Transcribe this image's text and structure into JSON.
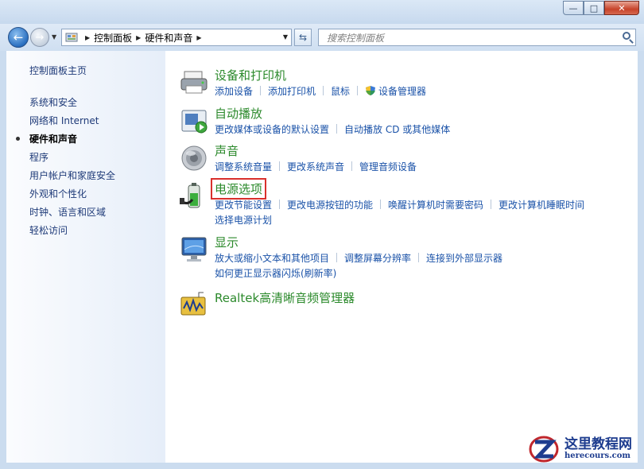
{
  "window": {
    "minimize_glyph": "—",
    "maximize_glyph": "□",
    "close_glyph": "✕"
  },
  "navbar": {
    "breadcrumb": [
      "控制面板",
      "硬件和声音"
    ],
    "search_placeholder": "搜索控制面板"
  },
  "sidebar": {
    "home": "控制面板主页",
    "items": [
      {
        "label": "系统和安全",
        "active": false
      },
      {
        "label": "网络和 Internet",
        "active": false
      },
      {
        "label": "硬件和声音",
        "active": true
      },
      {
        "label": "程序",
        "active": false
      },
      {
        "label": "用户帐户和家庭安全",
        "active": false
      },
      {
        "label": "外观和个性化",
        "active": false
      },
      {
        "label": "时钟、语言和区域",
        "active": false
      },
      {
        "label": "轻松访问",
        "active": false
      }
    ]
  },
  "categories": [
    {
      "title": "设备和打印机",
      "icon": "printer-icon",
      "rows": [
        [
          "添加设备",
          "添加打印机",
          "鼠标",
          "设备管理器"
        ]
      ]
    },
    {
      "title": "自动播放",
      "icon": "autoplay-icon",
      "rows": [
        [
          "更改媒体或设备的默认设置",
          "自动播放 CD 或其他媒体"
        ]
      ]
    },
    {
      "title": "声音",
      "icon": "speaker-icon",
      "rows": [
        [
          "调整系统音量",
          "更改系统声音",
          "管理音频设备"
        ]
      ]
    },
    {
      "title": "电源选项",
      "icon": "battery-icon",
      "highlighted": true,
      "rows": [
        [
          "更改节能设置",
          "更改电源按钮的功能",
          "唤醒计算机时需要密码",
          "更改计算机睡眠时间"
        ],
        [
          "选择电源计划"
        ]
      ]
    },
    {
      "title": "显示",
      "icon": "monitor-icon",
      "rows": [
        [
          "放大或缩小文本和其他项目",
          "调整屏幕分辨率",
          "连接到外部显示器"
        ],
        [
          "如何更正显示器闪烁(刷新率)"
        ]
      ]
    },
    {
      "title": "Realtek高清晰音频管理器",
      "icon": "realtek-audio-icon",
      "rows": []
    }
  ],
  "watermark": {
    "title": "这里教程网",
    "url": "herecours.com"
  },
  "colors": {
    "link": "#1a52a8",
    "category_title": "#2c8a2c",
    "highlight_box": "#d9302c"
  }
}
